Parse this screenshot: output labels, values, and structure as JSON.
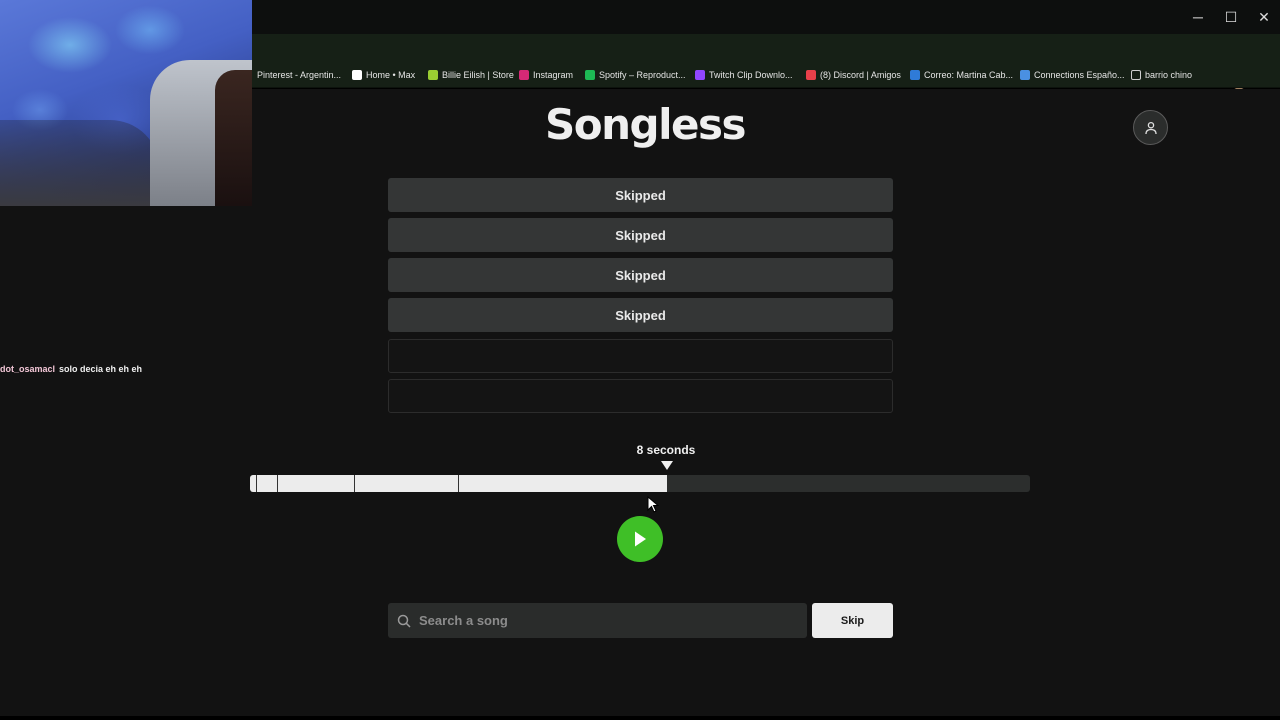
{
  "browser": {
    "window_controls": {
      "minimize": "─",
      "maximize": "☐",
      "close": "✕"
    },
    "toolbar_icons": [
      "star-icon",
      "extension-icon",
      "puzzle-icon",
      "profile-avatar-icon",
      "kebab-menu-icon"
    ],
    "bookmarks": [
      {
        "label": "Pinterest - Argentin...",
        "icon": "pinterest-icon",
        "color": "#162016"
      },
      {
        "label": "Home • Max",
        "icon": "max-icon",
        "color": "#ffffff"
      },
      {
        "label": "Billie Eilish | Store",
        "icon": "billie-icon",
        "color": "#9acd32"
      },
      {
        "label": "Instagram",
        "icon": "instagram-icon",
        "color": "#d62976"
      },
      {
        "label": "Spotify – Reproduct...",
        "icon": "spotify-icon",
        "color": "#1db954"
      },
      {
        "label": "Twitch Clip Downlo...",
        "icon": "twitch-icon",
        "color": "#9146ff"
      },
      {
        "label": "(8) Discord | Amigos",
        "icon": "discord-icon",
        "color": "#e8404a"
      },
      {
        "label": "Correo: Martina Cab...",
        "icon": "outlook-icon",
        "color": "#2f7bd8"
      },
      {
        "label": "Connections Españo...",
        "icon": "connections-icon",
        "color": "#4a90e2"
      },
      {
        "label": "barrio chino",
        "icon": "folder-icon",
        "color": "#d0d0d0"
      }
    ]
  },
  "app": {
    "logo": "Songless",
    "guesses": [
      {
        "text": "Skipped",
        "status": "skipped"
      },
      {
        "text": "Skipped",
        "status": "skipped"
      },
      {
        "text": "Skipped",
        "status": "skipped"
      },
      {
        "text": "Skipped",
        "status": "skipped"
      },
      {
        "text": "",
        "status": "empty"
      },
      {
        "text": "",
        "status": "empty"
      }
    ],
    "player": {
      "seconds_label": "8 seconds",
      "progress_fraction": 0.535,
      "accent_color": "#3fbf27"
    },
    "search": {
      "placeholder": "Search a song",
      "value": ""
    },
    "skip_label": "Skip"
  },
  "stream": {
    "chat": {
      "user": "dot_osamacl",
      "message": "solo decia eh eh eh"
    }
  }
}
